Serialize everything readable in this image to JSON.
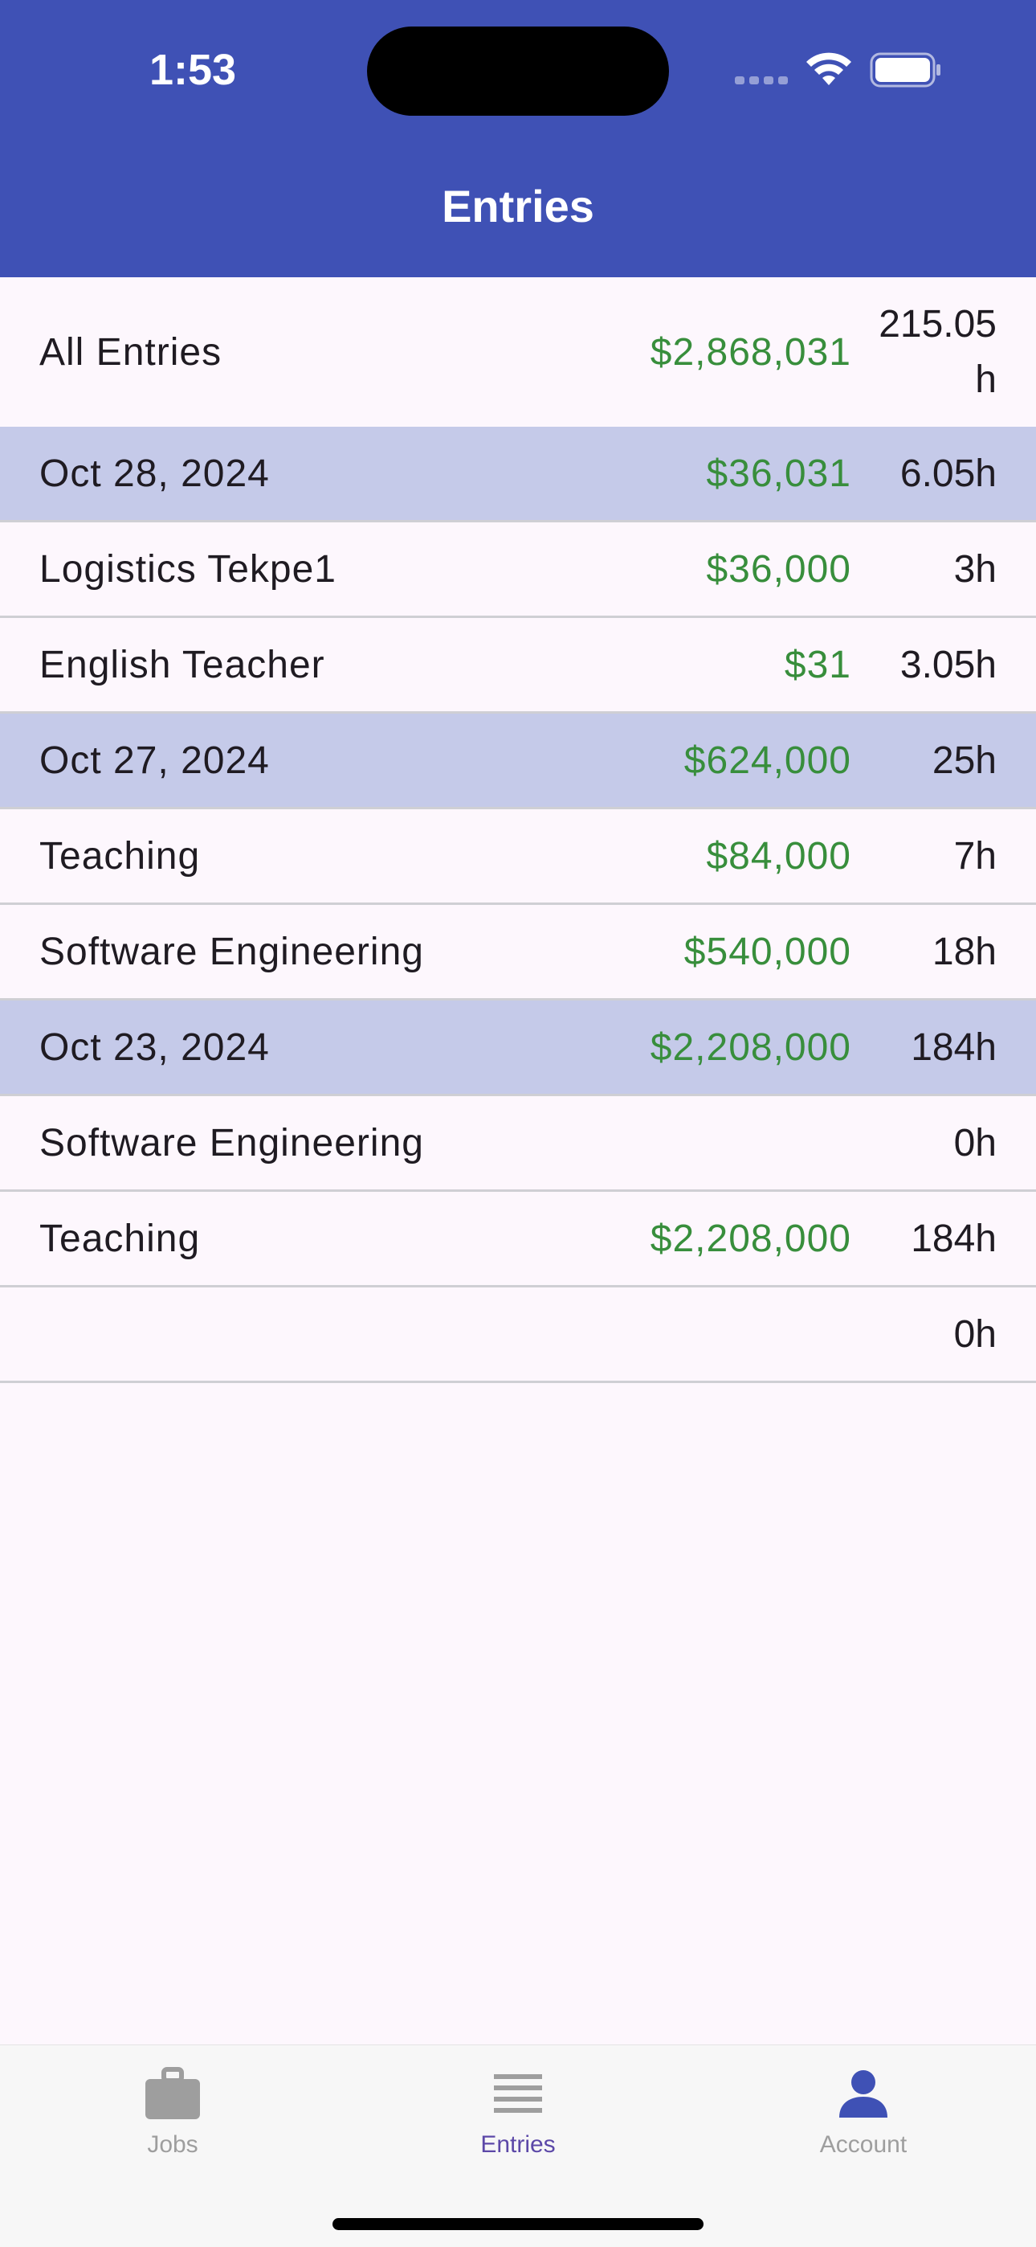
{
  "status_bar": {
    "time": "1:53"
  },
  "header": {
    "title": "Entries"
  },
  "summary": {
    "label": "All Entries",
    "pay": "$2,868,031",
    "hours_line1": "215.05",
    "hours_line2": "h"
  },
  "rows": [
    {
      "type": "day",
      "label": "Oct 28, 2024",
      "pay": "$36,031",
      "hours": "6.05h"
    },
    {
      "type": "entry",
      "label": "Logistics Tekpe1",
      "pay": "$36,000",
      "hours": "3h"
    },
    {
      "type": "entry",
      "label": "English Teacher",
      "pay": "$31",
      "hours": "3.05h"
    },
    {
      "type": "day",
      "label": "Oct 27, 2024",
      "pay": "$624,000",
      "hours": "25h"
    },
    {
      "type": "entry",
      "label": "Teaching",
      "pay": "$84,000",
      "hours": "7h"
    },
    {
      "type": "entry",
      "label": "Software Engineering",
      "pay": "$540,000",
      "hours": "18h"
    },
    {
      "type": "day",
      "label": "Oct 23, 2024",
      "pay": "$2,208,000",
      "hours": "184h"
    },
    {
      "type": "entry",
      "label": "Software Engineering",
      "pay": "",
      "hours": "0h"
    },
    {
      "type": "entry",
      "label": "Teaching",
      "pay": "$2,208,000",
      "hours": "184h"
    },
    {
      "type": "entry",
      "label": "",
      "pay": "",
      "hours": "0h"
    }
  ],
  "nav": {
    "items": [
      {
        "label": "Jobs",
        "icon": "briefcase-icon",
        "color": "#9e9e9e"
      },
      {
        "label": "Entries",
        "icon": "list-icon",
        "color": "#5c48a8"
      },
      {
        "label": "Account",
        "icon": "person-icon",
        "color": "#9e9e9e"
      }
    ]
  },
  "colors": {
    "app_bar": "#3f51b5",
    "day_row": "#c5cae9",
    "pay_text": "#388e3c",
    "background": "#fdf7fd"
  }
}
